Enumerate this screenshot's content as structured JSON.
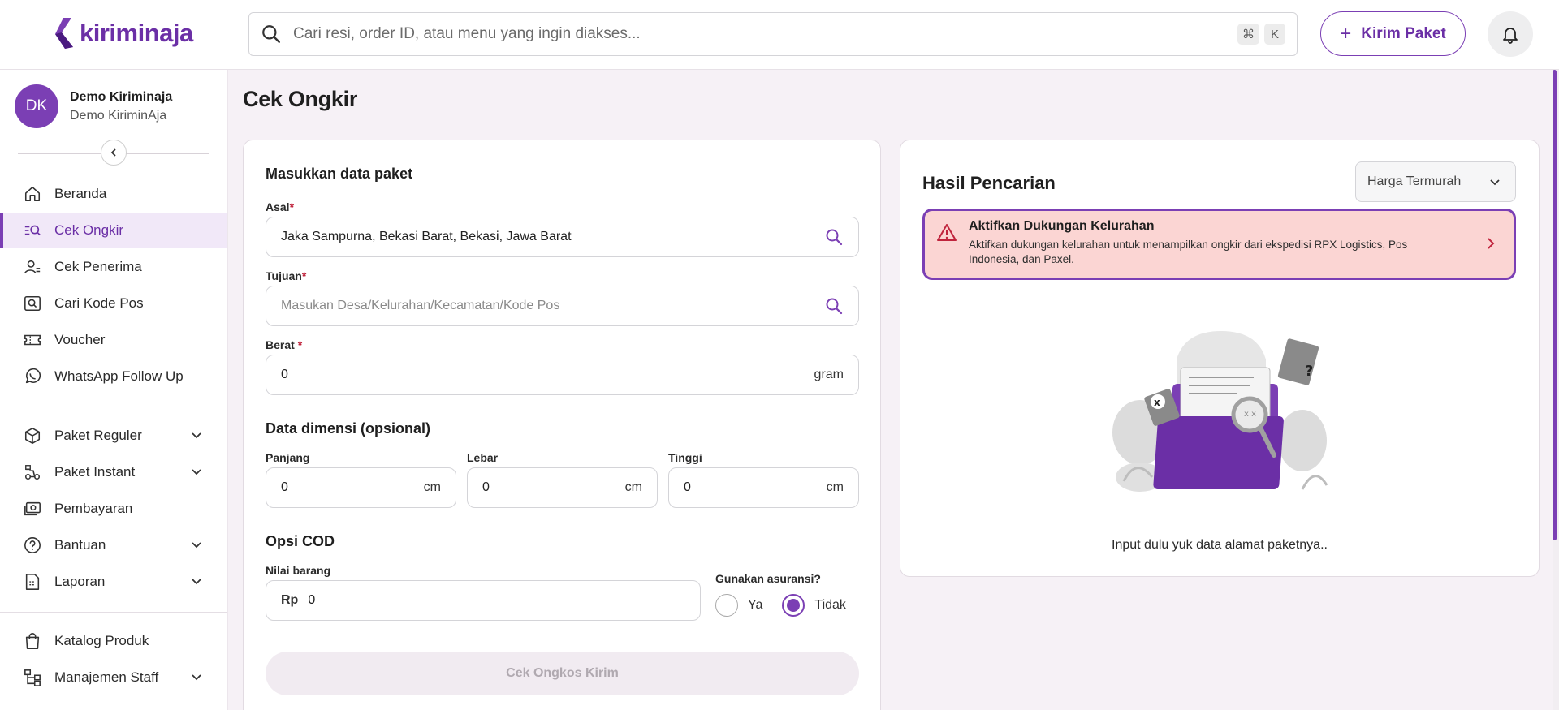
{
  "header": {
    "brand": "kiriminaja",
    "search_placeholder": "Cari resi, order ID, atau menu yang ingin diakses...",
    "shortcut_keys": [
      "⌘",
      "K"
    ],
    "send_button_label": "Kirim Paket",
    "bell_icon": "bell-icon"
  },
  "profile": {
    "initials": "DK",
    "name": "Demo Kiriminaja",
    "subtitle": "Demo KiriminAja"
  },
  "sidebar": {
    "items": [
      {
        "label": "Beranda",
        "icon": "home-icon",
        "active": false
      },
      {
        "label": "Cek Ongkir",
        "icon": "shipping-cost-icon",
        "active": true
      },
      {
        "label": "Cek Penerima",
        "icon": "user-check-icon",
        "active": false
      },
      {
        "label": "Cari Kode Pos",
        "icon": "postcode-search-icon",
        "active": false
      },
      {
        "label": "Voucher",
        "icon": "voucher-icon",
        "active": false
      },
      {
        "label": "WhatsApp Follow Up",
        "icon": "whatsapp-icon",
        "active": false
      },
      {
        "label": "Paket Reguler",
        "icon": "box-icon",
        "expandable": true
      },
      {
        "label": "Paket Instant",
        "icon": "delivery-icon",
        "expandable": true
      },
      {
        "label": "Pembayaran",
        "icon": "cash-icon"
      },
      {
        "label": "Bantuan",
        "icon": "help-icon",
        "expandable": true
      },
      {
        "label": "Laporan",
        "icon": "report-icon",
        "expandable": true
      },
      {
        "label": "Katalog Produk",
        "icon": "shopping-bag-icon"
      },
      {
        "label": "Manajemen Staff",
        "icon": "org-chart-icon",
        "expandable": true
      }
    ]
  },
  "page": {
    "title": "Cek Ongkir"
  },
  "form": {
    "section_package": "Masukkan data paket",
    "origin_label": "Asal",
    "origin_value": "Jaka Sampurna, Bekasi Barat, Bekasi, Jawa Barat",
    "destination_label": "Tujuan",
    "destination_placeholder": "Masukan Desa/Kelurahan/Kecamatan/Kode Pos",
    "weight_label": "Berat",
    "weight_value": "0",
    "weight_unit": "gram",
    "required_mark": "*",
    "section_dimension": "Data dimensi (opsional)",
    "length_label": "Panjang",
    "length_value": "0",
    "width_label": "Lebar",
    "width_value": "0",
    "height_label": "Tinggi",
    "height_value": "0",
    "dimension_unit": "cm",
    "section_cod": "Opsi COD",
    "goods_value_label": "Nilai barang",
    "currency_prefix": "Rp",
    "goods_value": "0",
    "insurance_label": "Gunakan asuransi?",
    "insurance_yes": "Ya",
    "insurance_no": "Tidak",
    "insurance_selected": "Tidak",
    "submit_label": "Cek Ongkos Kirim"
  },
  "results": {
    "title": "Hasil Pencarian",
    "sort_selected": "Harga Termurah",
    "alert_title": "Aktifkan Dukungan Kelurahan",
    "alert_text": "Aktifkan dukungan kelurahan untuk menampilkan ongkir dari ekspedisi RPX Logistics, Pos Indonesia, dan Paxel.",
    "empty_text": "Input dulu yuk data alamat paketnya.."
  },
  "colors": {
    "brand": "#7b3fb4",
    "alert_bg": "#fbd5d3",
    "alert_icon": "#c0243d"
  }
}
